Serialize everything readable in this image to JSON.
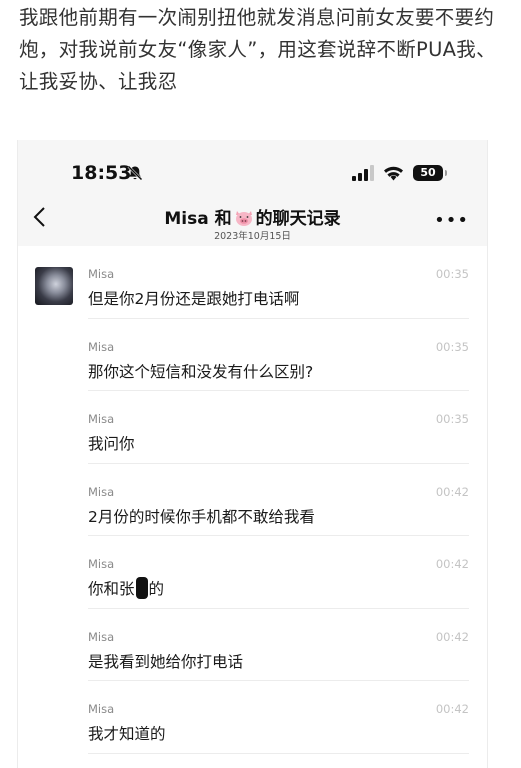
{
  "post": {
    "text": "我跟他前期有一次闹别扭他就发消息问前女友要不要约炮，对我说前女友“像家人”，用这套说辞不断PUA我、让我妥协、让我忍"
  },
  "status_bar": {
    "time": "18:53",
    "battery": "50"
  },
  "nav": {
    "title_part1": "Misa 和",
    "title_part2": "的聊天记录",
    "subtitle": "2023年10月15日",
    "more": "•••"
  },
  "messages": [
    {
      "sender": "Misa",
      "time": "00:35",
      "text": "但是你2月份还是跟她打电话啊",
      "avatar": true
    },
    {
      "sender": "Misa",
      "time": "00:35",
      "text": "那你这个短信和没发有什么区别?"
    },
    {
      "sender": "Misa",
      "time": "00:35",
      "text": "我问你"
    },
    {
      "sender": "Misa",
      "time": "00:42",
      "text": "2月份的时候你手机都不敢给我看"
    },
    {
      "sender": "Misa",
      "time": "00:42",
      "text_before": "你和张",
      "text_after": "的",
      "redacted": true
    },
    {
      "sender": "Misa",
      "time": "00:42",
      "text": "是我看到她给你打电话"
    },
    {
      "sender": "Misa",
      "time": "00:42",
      "text": "我才知道的"
    }
  ]
}
